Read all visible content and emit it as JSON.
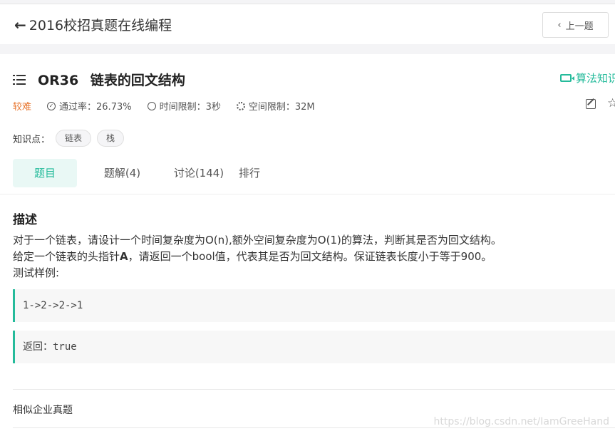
{
  "header": {
    "back_arrow": "🡐",
    "back_title": "2016校招真题在线编程",
    "prev_label": "上一题"
  },
  "problem": {
    "id": "OR36",
    "title": "链表的回文结构",
    "algo_link": "算法知识",
    "difficulty": "较难",
    "pass_rate": "通过率：26.73%",
    "time_limit": "时间限制：3秒",
    "space_limit": "空间限制：32M",
    "knowledge_label": "知识点：",
    "tags": [
      "链表",
      "栈"
    ]
  },
  "tabs": [
    "题目",
    "题解(4)",
    "讨论(144)",
    "排行"
  ],
  "description": {
    "heading": "描述",
    "line1": "对于一个链表，请设计一个时间复杂度为O(n),额外空间复杂度为O(1)的算法，判断其是否为回文结构。",
    "line2_pre": "给定一个链表的头指针",
    "line2_bold": "A",
    "line2_post": "，请返回一个bool值，代表其是否为回文结构。保证链表长度小于等于900。",
    "line3": "测试样例:",
    "example_input": "1->2->2->1",
    "example_output": "返回：true"
  },
  "similar": "相似企业真题",
  "watermark": "https://blog.csdn.net/IamGreeHand",
  "colors": {
    "accent": "#25bb9b",
    "difficulty": "#e8762f"
  }
}
